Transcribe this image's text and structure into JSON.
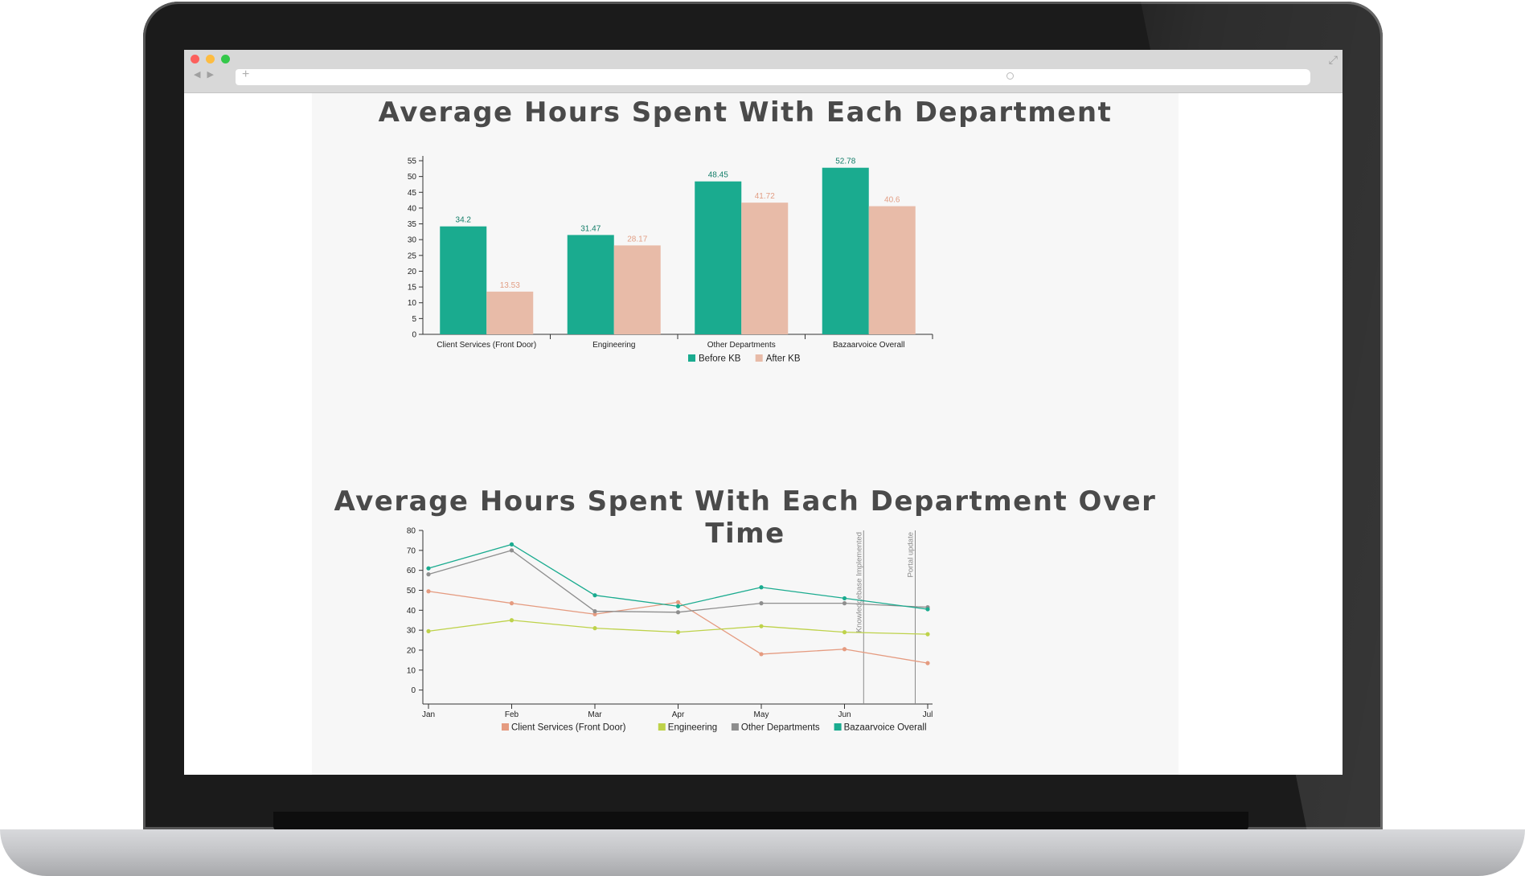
{
  "colors": {
    "before": "#1aab8f",
    "after": "#e8bba8",
    "client": "#e59b80",
    "engineering": "#bed24a",
    "other": "#8e8e8e",
    "overall": "#1aab8f"
  },
  "chart_data": [
    {
      "type": "bar",
      "title": "Average Hours Spent With Each Department",
      "categories": [
        "Client Services (Front Door)",
        "Engineering",
        "Other Departments",
        "Bazaarvoice Overall"
      ],
      "series": [
        {
          "name": "Before KB",
          "values": [
            34.2,
            31.47,
            48.45,
            52.78
          ],
          "labels": [
            "34.2",
            "31.47",
            "48.45",
            "52.78"
          ]
        },
        {
          "name": "After KB",
          "values": [
            13.53,
            28.17,
            41.72,
            40.6
          ],
          "labels": [
            "13.53",
            "28.17",
            "41.72",
            "40.6"
          ]
        }
      ],
      "ylim": [
        0,
        55
      ],
      "yticks": [
        "0",
        "5",
        "10",
        "15",
        "20",
        "25",
        "30",
        "35",
        "40",
        "45",
        "50",
        "55"
      ],
      "legend_position": "bottom"
    },
    {
      "type": "line",
      "title": "Average Hours Spent With Each Department Over Time",
      "x": [
        "Jan",
        "Feb",
        "Mar",
        "Apr",
        "May",
        "Jun",
        "Jul"
      ],
      "series": [
        {
          "name": "Client Services (Front Door)",
          "values": [
            49.5,
            43.5,
            38,
            44,
            18,
            20.5,
            13.5
          ]
        },
        {
          "name": "Engineering",
          "values": [
            29.5,
            35,
            31,
            29,
            32,
            29,
            28
          ]
        },
        {
          "name": "Other Departments",
          "values": [
            58,
            70,
            39.5,
            39,
            43.5,
            43.5,
            41.5
          ]
        },
        {
          "name": "Bazaarvoice Overall",
          "values": [
            61,
            73,
            47.5,
            42,
            51.5,
            46,
            40.5
          ]
        }
      ],
      "ylim": [
        -7,
        80
      ],
      "yticks": [
        "0",
        "10",
        "20",
        "30",
        "40",
        "50",
        "60",
        "70",
        "80"
      ],
      "annotations": [
        {
          "label": "Knowledgebase Implemented",
          "x": "mid-June"
        },
        {
          "label": "Portal update",
          "x": "early July"
        }
      ],
      "legend_position": "bottom"
    }
  ]
}
